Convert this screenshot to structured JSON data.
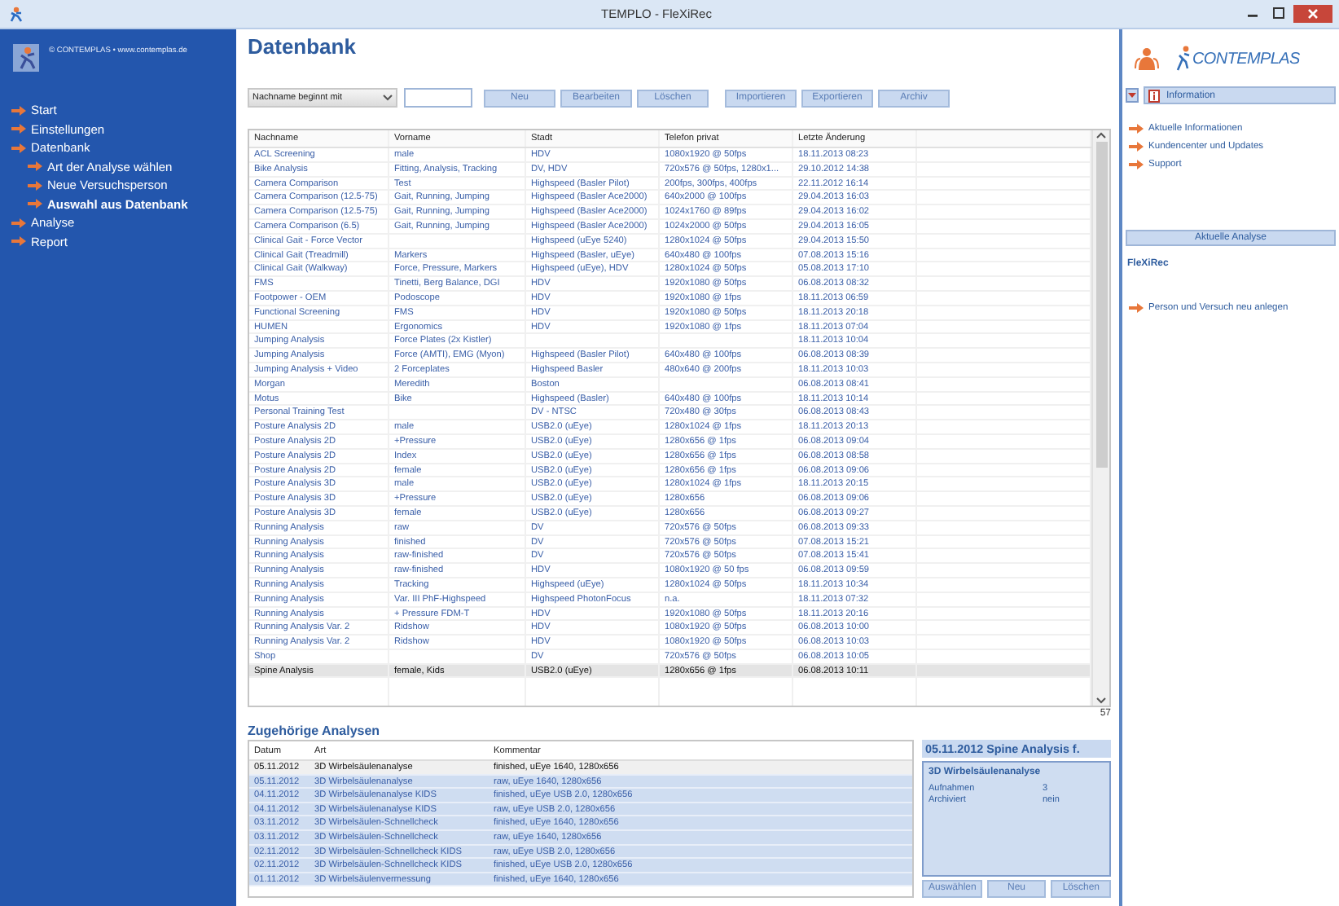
{
  "window": {
    "title": "TEMPLO - FleXiRec"
  },
  "sidebar": {
    "copyright": "© CONTEMPLAS • www.contemplas.de",
    "items": [
      {
        "label": "Start",
        "selected": false
      },
      {
        "label": "Einstellungen",
        "selected": false
      },
      {
        "label": "Datenbank",
        "selected": false,
        "children": [
          {
            "label": "Art der Analyse wählen",
            "selected": false
          },
          {
            "label": "Neue Versuchsperson",
            "selected": false
          },
          {
            "label": "Auswahl aus Datenbank",
            "selected": true
          }
        ]
      },
      {
        "label": "Analyse",
        "selected": false
      },
      {
        "label": "Report",
        "selected": false
      }
    ]
  },
  "page": {
    "title": "Datenbank"
  },
  "toolbar": {
    "filter": "Nachname beginnt mit",
    "button_groups": [
      [
        "Neu",
        "Bearbeiten",
        "Löschen"
      ],
      [
        "Importieren",
        "Exportieren",
        "Archiv"
      ]
    ]
  },
  "table": {
    "columns": [
      "Nachname",
      "Vorname",
      "Stadt",
      "Telefon privat",
      "Letzte Änderung"
    ],
    "rows": [
      {
        "nachname": "ACL Screening",
        "vorname": "male",
        "stadt": "HDV",
        "telefon": "1080x1920 @ 50fps",
        "geaendert": "18.11.2013 08:23",
        "selected": false
      },
      {
        "nachname": "Bike Analysis",
        "vorname": "Fitting, Analysis, Tracking",
        "stadt": "DV, HDV",
        "telefon": "720x576 @ 50fps, 1280x1...",
        "geaendert": "29.10.2012 14:38",
        "selected": false
      },
      {
        "nachname": "Camera Comparison",
        "vorname": "Test",
        "stadt": "Highspeed (Basler Pilot)",
        "telefon": "200fps, 300fps, 400fps",
        "geaendert": "22.11.2012 16:14",
        "selected": false
      },
      {
        "nachname": "Camera Comparison (12.5-75)",
        "vorname": "Gait, Running, Jumping",
        "stadt": "Highspeed (Basler Ace2000)",
        "telefon": "640x2000 @ 100fps",
        "geaendert": "29.04.2013 16:03",
        "selected": false
      },
      {
        "nachname": "Camera Comparison (12.5-75)",
        "vorname": "Gait, Running, Jumping",
        "stadt": "Highspeed (Basler Ace2000)",
        "telefon": "1024x1760 @ 89fps",
        "geaendert": "29.04.2013 16:02",
        "selected": false
      },
      {
        "nachname": "Camera Comparison (6.5)",
        "vorname": "Gait, Running, Jumping",
        "stadt": "Highspeed (Basler Ace2000)",
        "telefon": "1024x2000 @ 50fps",
        "geaendert": "29.04.2013 16:05",
        "selected": false
      },
      {
        "nachname": "Clinical Gait - Force Vector",
        "stadt": "Highspeed (uEye 5240)",
        "telefon": "1280x1024 @ 50fps",
        "geaendert": "29.04.2013 15:50",
        "selected": false
      },
      {
        "nachname": "Clinical Gait (Treadmill)",
        "vorname": "Markers",
        "stadt": "Highspeed (Basler, uEye)",
        "telefon": "640x480 @ 100fps",
        "geaendert": "07.08.2013 15:16",
        "selected": false
      },
      {
        "nachname": "Clinical Gait (Walkway)",
        "vorname": "Force, Pressure, Markers",
        "stadt": "Highspeed (uEye), HDV",
        "telefon": "1280x1024 @ 50fps",
        "geaendert": "05.08.2013 17:10",
        "selected": false
      },
      {
        "nachname": "FMS",
        "vorname": "Tinetti, Berg Balance, DGI",
        "stadt": "HDV",
        "telefon": "1920x1080 @ 50fps",
        "geaendert": "06.08.2013 08:32",
        "selected": false
      },
      {
        "nachname": "Footpower - OEM",
        "vorname": "Podoscope",
        "stadt": "HDV",
        "telefon": "1920x1080 @ 1fps",
        "geaendert": "18.11.2013 06:59",
        "selected": false
      },
      {
        "nachname": "Functional Screening",
        "vorname": "FMS",
        "stadt": "HDV",
        "telefon": "1920x1080 @ 50fps",
        "geaendert": "18.11.2013 20:18",
        "selected": false
      },
      {
        "nachname": "HUMEN",
        "vorname": "Ergonomics",
        "stadt": "HDV",
        "telefon": "1920x1080 @ 1fps",
        "geaendert": "18.11.2013 07:04",
        "selected": false
      },
      {
        "nachname": "Jumping Analysis",
        "vorname": "Force Plates (2x Kistler)",
        "geaendert": "18.11.2013 10:04",
        "selected": false
      },
      {
        "nachname": "Jumping Analysis",
        "vorname": "Force (AMTI), EMG (Myon)",
        "stadt": "Highspeed (Basler Pilot)",
        "telefon": "640x480 @ 100fps",
        "geaendert": "06.08.2013 08:39",
        "selected": false
      },
      {
        "nachname": "Jumping Analysis + Video",
        "vorname": "2 Forceplates",
        "stadt": "Highspeed Basler",
        "telefon": "480x640 @ 200fps",
        "geaendert": "18.11.2013 10:03",
        "selected": false
      },
      {
        "nachname": "Morgan",
        "vorname": "Meredith",
        "stadt": "Boston",
        "geaendert": "06.08.2013 08:41",
        "selected": false
      },
      {
        "nachname": "Motus",
        "vorname": "Bike",
        "stadt": "Highspeed (Basler)",
        "telefon": "640x480 @ 100fps",
        "geaendert": "18.11.2013 10:14",
        "selected": false
      },
      {
        "nachname": "Personal Training Test",
        "stadt": "DV - NTSC",
        "telefon": "720x480 @ 30fps",
        "geaendert": "06.08.2013 08:43",
        "selected": false
      },
      {
        "nachname": "Posture Analysis 2D",
        "vorname": "male",
        "stadt": "USB2.0 (uEye)",
        "telefon": "1280x1024 @ 1fps",
        "geaendert": "18.11.2013 20:13",
        "selected": false
      },
      {
        "nachname": "Posture Analysis 2D",
        "vorname": "+Pressure",
        "stadt": "USB2.0 (uEye)",
        "telefon": "1280x656 @ 1fps",
        "geaendert": "06.08.2013 09:04",
        "selected": false
      },
      {
        "nachname": "Posture Analysis 2D",
        "vorname": "Index",
        "stadt": "USB2.0 (uEye)",
        "telefon": "1280x656 @ 1fps",
        "geaendert": "06.08.2013 08:58",
        "selected": false
      },
      {
        "nachname": "Posture Analysis 2D",
        "vorname": "female",
        "stadt": "USB2.0 (uEye)",
        "telefon": "1280x656 @ 1fps",
        "geaendert": "06.08.2013 09:06",
        "selected": false
      },
      {
        "nachname": "Posture Analysis 3D",
        "vorname": "male",
        "stadt": "USB2.0 (uEye)",
        "telefon": "1280x1024 @ 1fps",
        "geaendert": "18.11.2013 20:15",
        "selected": false
      },
      {
        "nachname": "Posture Analysis 3D",
        "vorname": "+Pressure",
        "stadt": "USB2.0 (uEye)",
        "telefon": "1280x656",
        "geaendert": "06.08.2013 09:06",
        "selected": false
      },
      {
        "nachname": "Posture Analysis 3D",
        "vorname": "female",
        "stadt": "USB2.0 (uEye)",
        "telefon": "1280x656",
        "geaendert": "06.08.2013 09:27",
        "selected": false
      },
      {
        "nachname": "Running Analysis",
        "vorname": "raw",
        "stadt": "DV",
        "telefon": "720x576 @ 50fps",
        "geaendert": "06.08.2013 09:33",
        "selected": false
      },
      {
        "nachname": "Running Analysis",
        "vorname": "finished",
        "stadt": "DV",
        "telefon": "720x576 @ 50fps",
        "geaendert": "07.08.2013 15:21",
        "selected": false
      },
      {
        "nachname": "Running Analysis",
        "vorname": "raw-finished",
        "stadt": "DV",
        "telefon": "720x576 @ 50fps",
        "geaendert": "07.08.2013 15:41",
        "selected": false
      },
      {
        "nachname": "Running Analysis",
        "vorname": "raw-finished",
        "stadt": "HDV",
        "telefon": "1080x1920 @ 50 fps",
        "geaendert": "06.08.2013 09:59",
        "selected": false
      },
      {
        "nachname": "Running Analysis",
        "vorname": "Tracking",
        "stadt": "Highspeed (uEye)",
        "telefon": "1280x1024 @ 50fps",
        "geaendert": "18.11.2013 10:34",
        "selected": false
      },
      {
        "nachname": "Running Analysis",
        "vorname": "Var. III PhF-Highspeed",
        "stadt": "Highspeed PhotonFocus",
        "telefon": "n.a.",
        "geaendert": "18.11.2013 07:32",
        "selected": false
      },
      {
        "nachname": "Running Analysis",
        "vorname": "+ Pressure FDM-T",
        "stadt": "HDV",
        "telefon": "1920x1080 @ 50fps",
        "geaendert": "18.11.2013 20:16",
        "selected": false
      },
      {
        "nachname": "Running Analysis Var. 2",
        "vorname": "Ridshow",
        "stadt": "HDV",
        "telefon": "1080x1920 @ 50fps",
        "geaendert": "06.08.2013 10:00",
        "selected": false
      },
      {
        "nachname": "Running Analysis Var. 2",
        "vorname": "Ridshow",
        "stadt": "HDV",
        "telefon": "1080x1920 @ 50fps",
        "geaendert": "06.08.2013 10:03",
        "selected": false
      },
      {
        "nachname": "Shop",
        "stadt": "DV",
        "telefon": "720x576 @ 50fps",
        "geaendert": "06.08.2013 10:05",
        "selected": false
      },
      {
        "nachname": "Spine Analysis",
        "vorname": "female, Kids",
        "stadt": "USB2.0 (uEye)",
        "telefon": "1280x656 @ 1fps",
        "geaendert": "06.08.2013 10:11",
        "selected": true
      }
    ],
    "count": "57"
  },
  "related": {
    "title": "Zugehörige Analysen",
    "columns": [
      "Datum",
      "Art",
      "Kommentar"
    ],
    "rows": [
      {
        "datum": "05.11.2012",
        "art": "3D Wirbelsäulenanalyse",
        "kommentar": "finished, uEye 1640, 1280x656",
        "selected": true
      },
      {
        "datum": "05.11.2012",
        "art": "3D Wirbelsäulenanalyse",
        "kommentar": "raw, uEye 1640, 1280x656",
        "selected": false
      },
      {
        "datum": "04.11.2012",
        "art": "3D Wirbelsäulenanalyse KIDS",
        "kommentar": "finished, uEye USB 2.0, 1280x656",
        "selected": false
      },
      {
        "datum": "04.11.2012",
        "art": "3D Wirbelsäulenanalyse KIDS",
        "kommentar": "raw, uEye USB 2.0, 1280x656",
        "selected": false
      },
      {
        "datum": "03.11.2012",
        "art": "3D Wirbelsäulen-Schnellcheck",
        "kommentar": "finished, uEye 1640, 1280x656",
        "selected": false
      },
      {
        "datum": "03.11.2012",
        "art": "3D Wirbelsäulen-Schnellcheck",
        "kommentar": "raw, uEye 1640, 1280x656",
        "selected": false
      },
      {
        "datum": "02.11.2012",
        "art": "3D Wirbelsäulen-Schnellcheck KIDS",
        "kommentar": "raw, uEye USB 2.0, 1280x656",
        "selected": false
      },
      {
        "datum": "02.11.2012",
        "art": "3D Wirbelsäulen-Schnellcheck KIDS",
        "kommentar": "finished, uEye USB 2.0, 1280x656",
        "selected": false
      },
      {
        "datum": "01.11.2012",
        "art": "3D Wirbelsäulenvermessung",
        "kommentar": "finished, uEye 1640, 1280x656",
        "selected": false
      }
    ]
  },
  "detail": {
    "title": "05.11.2012 Spine Analysis f.",
    "subtitle": "3D Wirbelsäulenanalyse",
    "fields": [
      {
        "label": "Aufnahmen",
        "value": "3"
      },
      {
        "label": "Archiviert",
        "value": "nein"
      }
    ],
    "buttons": [
      "Auswählen",
      "Neu",
      "Löschen"
    ]
  },
  "right_panel": {
    "logo": "CONTEMPLAS",
    "info_header": "Information",
    "links": [
      "Aktuelle Informationen",
      "Kundencenter und Updates",
      "Support"
    ],
    "analysis_header": "Aktuelle Analyse",
    "analysis_name": "FleXiRec",
    "actions": [
      "Person und Versuch neu anlegen"
    ]
  }
}
